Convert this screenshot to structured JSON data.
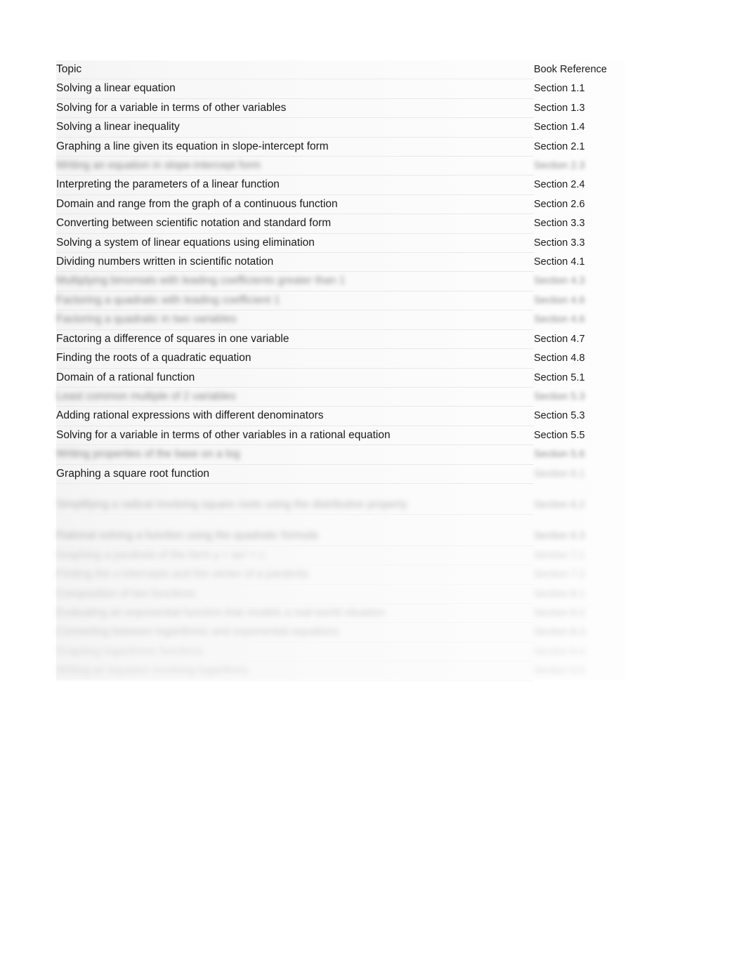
{
  "document": {
    "kind": "table",
    "background_color": "#ffffff",
    "panel_color": "#f6f6f6",
    "text_color": "#1a1a1a",
    "rule_color": "#e9e9e9"
  },
  "table": {
    "columns": [
      {
        "key": "topic",
        "header": "Topic"
      },
      {
        "key": "reference",
        "header": "Book Reference"
      }
    ],
    "rows": [
      {
        "topic": "Solving a linear equation",
        "reference": "Section 1.1",
        "blur": 0
      },
      {
        "topic": "Solving for a variable in terms of other variables",
        "reference": "Section 1.3",
        "blur": 0
      },
      {
        "topic": "Solving a linear inequality",
        "reference": "Section 1.4",
        "blur": 0
      },
      {
        "topic": "Graphing a line given its equation in slope-intercept form",
        "reference": "Section 2.1",
        "blur": 0
      },
      {
        "topic": "Writing an equation in slope-intercept form",
        "reference": "Section 2.3",
        "blur": 1
      },
      {
        "topic": "Interpreting the parameters of a linear function",
        "reference": "Section 2.4",
        "blur": 0
      },
      {
        "topic": "Domain and range from the graph of a continuous function",
        "reference": "Section 2.6",
        "blur": 0
      },
      {
        "topic": "Converting between scientific notation and standard form",
        "reference": "Section 3.3",
        "blur": 0
      },
      {
        "topic": "Solving a system of linear equations using elimination",
        "reference": "Section 3.3",
        "blur": 0
      },
      {
        "topic": "Dividing numbers written in scientific notation",
        "reference": "Section 4.1",
        "blur": 0
      },
      {
        "topic": "Multiplying binomials with leading coefficients greater than 1",
        "reference": "Section 4.3",
        "blur": 1
      },
      {
        "topic": "Factoring a quadratic with leading coefficient 1",
        "reference": "Section 4.6",
        "blur": 1
      },
      {
        "topic": "Factoring a quadratic in two variables",
        "reference": "Section 4.6",
        "blur": 1
      },
      {
        "topic": "Factoring a difference of squares in one variable",
        "reference": "Section 4.7",
        "blur": 0
      },
      {
        "topic": "Finding the roots of a quadratic equation",
        "reference": "Section 4.8",
        "blur": 0
      },
      {
        "topic": "Domain of a rational function",
        "reference": "Section 5.1",
        "blur": 0
      },
      {
        "topic": "Least common multiple of 2 variables",
        "reference": "Section 5.3",
        "blur": 1
      },
      {
        "topic": "Adding rational expressions with different denominators",
        "reference": "Section 5.3",
        "blur": 0
      },
      {
        "topic": "Solving for a variable in terms of other variables in a rational equation",
        "reference": "Section 5.5",
        "blur": 0
      },
      {
        "topic": "Writing properties of the base on a log",
        "reference": "Section 5.6",
        "blur": 1
      },
      {
        "topic": "Graphing a square root function",
        "reference": "Section 6.1",
        "blur": 0,
        "ref_blur": 2
      },
      {
        "topic": "",
        "reference": "",
        "blur": 0,
        "gap": true
      },
      {
        "topic": "Simplifying a radical involving square roots using the distributive property",
        "reference": "Section 6.2",
        "blur": 2
      },
      {
        "topic": "",
        "reference": "",
        "blur": 0,
        "gap": true
      },
      {
        "topic": "Rational solving a function using the quadratic formula",
        "reference": "Section 6.3",
        "blur": 2
      },
      {
        "topic": "Graphing a parabola of the form y = ax² + c",
        "reference": "Section 7.1",
        "blur": 3
      },
      {
        "topic": "Finding the x-intercepts and the vertex of a parabola",
        "reference": "Section 7.2",
        "blur": 3
      },
      {
        "topic": "Composition of two functions",
        "reference": "Section 8.1",
        "blur": 3
      },
      {
        "topic": "Evaluating an exponential function that models a real-world situation",
        "reference": "Section 8.2",
        "blur": 3
      },
      {
        "topic": "Converting between logarithmic and exponential equations",
        "reference": "Section 8.3",
        "blur": 3
      },
      {
        "topic": "Graphing logarithmic functions",
        "reference": "Section 8.4",
        "blur": 4
      },
      {
        "topic": "Writing an equation involving logarithms",
        "reference": "Section 8.5",
        "blur": 4
      }
    ]
  }
}
